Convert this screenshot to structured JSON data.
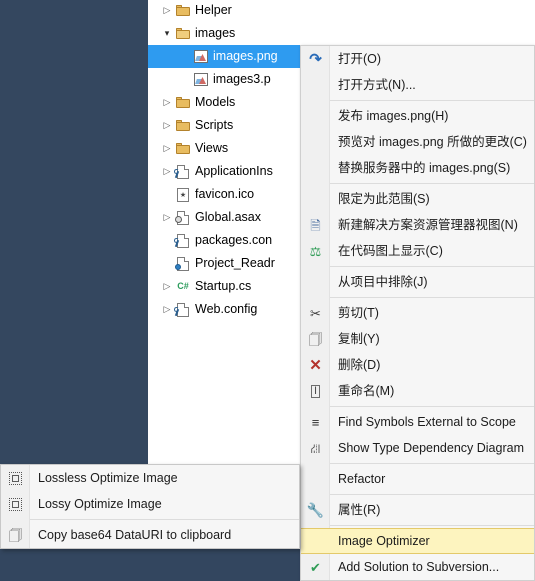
{
  "ide": {
    "background_color": "#34475f",
    "panel_background": "#ffffff",
    "selection_color": "#2e9bf0",
    "highlight_color": "#fdf4bf"
  },
  "tree": {
    "items": [
      {
        "label": "Helper",
        "indent": 1,
        "expander": "collapsed",
        "icon": "folder-icon",
        "selected": false
      },
      {
        "label": "images",
        "indent": 1,
        "expander": "expanded",
        "icon": "folder-open-icon",
        "selected": false
      },
      {
        "label": "images.png",
        "indent": 2,
        "expander": "none",
        "icon": "image-file-icon",
        "selected": true
      },
      {
        "label": "images3.p",
        "indent": 2,
        "expander": "none",
        "icon": "image-file-icon",
        "selected": false
      },
      {
        "label": "Models",
        "indent": 1,
        "expander": "collapsed",
        "icon": "folder-icon",
        "selected": false
      },
      {
        "label": "Scripts",
        "indent": 1,
        "expander": "collapsed",
        "icon": "folder-icon",
        "selected": false
      },
      {
        "label": "Views",
        "indent": 1,
        "expander": "collapsed",
        "icon": "folder-icon",
        "selected": false
      },
      {
        "label": "ApplicationIns",
        "indent": 1,
        "expander": "collapsed",
        "icon": "config-file-icon",
        "selected": false
      },
      {
        "label": "favicon.ico",
        "indent": 1,
        "expander": "none",
        "icon": "ico-file-icon",
        "selected": false
      },
      {
        "label": "Global.asax",
        "indent": 1,
        "expander": "collapsed",
        "icon": "asax-file-icon",
        "selected": false
      },
      {
        "label": "packages.con",
        "indent": 1,
        "expander": "none",
        "icon": "config-file-icon",
        "selected": false
      },
      {
        "label": "Project_Readr",
        "indent": 1,
        "expander": "none",
        "icon": "readme-file-icon",
        "selected": false
      },
      {
        "label": "Startup.cs",
        "indent": 1,
        "expander": "collapsed",
        "icon": "csharp-file-icon",
        "selected": false
      },
      {
        "label": "Web.config",
        "indent": 1,
        "expander": "collapsed",
        "icon": "config-file-icon",
        "selected": false
      }
    ]
  },
  "context_menu": {
    "items": [
      {
        "type": "item",
        "label": "打开(O)",
        "icon": "open-arrow-icon",
        "highlighted": false
      },
      {
        "type": "item",
        "label": "打开方式(N)...",
        "icon": "",
        "highlighted": false
      },
      {
        "type": "separator"
      },
      {
        "type": "item",
        "label": "发布 images.png(H)",
        "icon": "",
        "highlighted": false
      },
      {
        "type": "item",
        "label": "预览对 images.png 所做的更改(C)",
        "icon": "",
        "highlighted": false
      },
      {
        "type": "item",
        "label": "替换服务器中的 images.png(S)",
        "icon": "",
        "highlighted": false
      },
      {
        "type": "separator"
      },
      {
        "type": "item",
        "label": "限定为此范围(S)",
        "icon": "",
        "highlighted": false
      },
      {
        "type": "item",
        "label": "新建解决方案资源管理器视图(N)",
        "icon": "new-view-icon",
        "highlighted": false
      },
      {
        "type": "item",
        "label": "在代码图上显示(C)",
        "icon": "code-map-icon",
        "highlighted": false
      },
      {
        "type": "separator"
      },
      {
        "type": "item",
        "label": "从项目中排除(J)",
        "icon": "",
        "highlighted": false
      },
      {
        "type": "separator"
      },
      {
        "type": "item",
        "label": "剪切(T)",
        "icon": "cut-icon",
        "highlighted": false
      },
      {
        "type": "item",
        "label": "复制(Y)",
        "icon": "copy-icon",
        "highlighted": false
      },
      {
        "type": "item",
        "label": "删除(D)",
        "icon": "delete-x-icon",
        "highlighted": false
      },
      {
        "type": "item",
        "label": "重命名(M)",
        "icon": "rename-icon",
        "highlighted": false
      },
      {
        "type": "separator"
      },
      {
        "type": "item",
        "label": "Find Symbols External to Scope",
        "icon": "find-symbols-icon",
        "highlighted": false
      },
      {
        "type": "item",
        "label": "Show Type Dependency Diagram",
        "icon": "type-dependency-icon",
        "highlighted": false
      },
      {
        "type": "separator"
      },
      {
        "type": "item",
        "label": "Refactor",
        "icon": "",
        "highlighted": false
      },
      {
        "type": "separator"
      },
      {
        "type": "item",
        "label": "属性(R)",
        "icon": "wrench-icon",
        "highlighted": false
      },
      {
        "type": "separator"
      },
      {
        "type": "item",
        "label": "Image Optimizer",
        "icon": "",
        "highlighted": true
      },
      {
        "type": "item",
        "label": "Add Solution to Subversion...",
        "icon": "subversion-icon",
        "highlighted": false
      }
    ]
  },
  "submenu": {
    "items": [
      {
        "type": "item",
        "label": "Lossless Optimize Image",
        "icon": "lossless-icon"
      },
      {
        "type": "item",
        "label": "Lossy Optimize Image",
        "icon": "lossy-icon"
      },
      {
        "type": "separator"
      },
      {
        "type": "item",
        "label": "Copy base64 DataURI to clipboard",
        "icon": "copy-icon"
      }
    ]
  }
}
